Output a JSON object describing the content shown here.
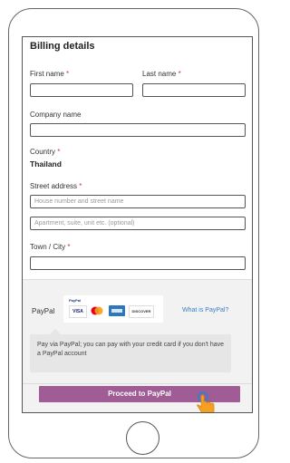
{
  "form": {
    "heading": "Billing details",
    "first_name_label": "First name",
    "last_name_label": "Last name",
    "company_label": "Company name",
    "country_label": "Country",
    "country_value": "Thailand",
    "street_label": "Street address",
    "street_placeholder": "House number and street name",
    "apartment_placeholder": "Apartment, suite, unit etc. (optional)",
    "town_label": "Town / City",
    "required_mark": "*"
  },
  "payment": {
    "method_label": "PayPal",
    "what_link": "What is PayPal?",
    "note": "Pay via PayPal; you can pay with your credit card if you don't have a PayPal account",
    "proceed_button": "Proceed to PayPal",
    "cards": {
      "paypal_mini": "PayPal",
      "visa": "VISA",
      "discover": "DISCOVER"
    }
  },
  "colors": {
    "accent_button": "#a05c94",
    "link": "#3a7fc4",
    "required": "#dd3333",
    "cursor": "#f5a023"
  },
  "icons": [
    "hand-pointer-icon",
    "click-ripple-icon",
    "home-button-icon"
  ]
}
